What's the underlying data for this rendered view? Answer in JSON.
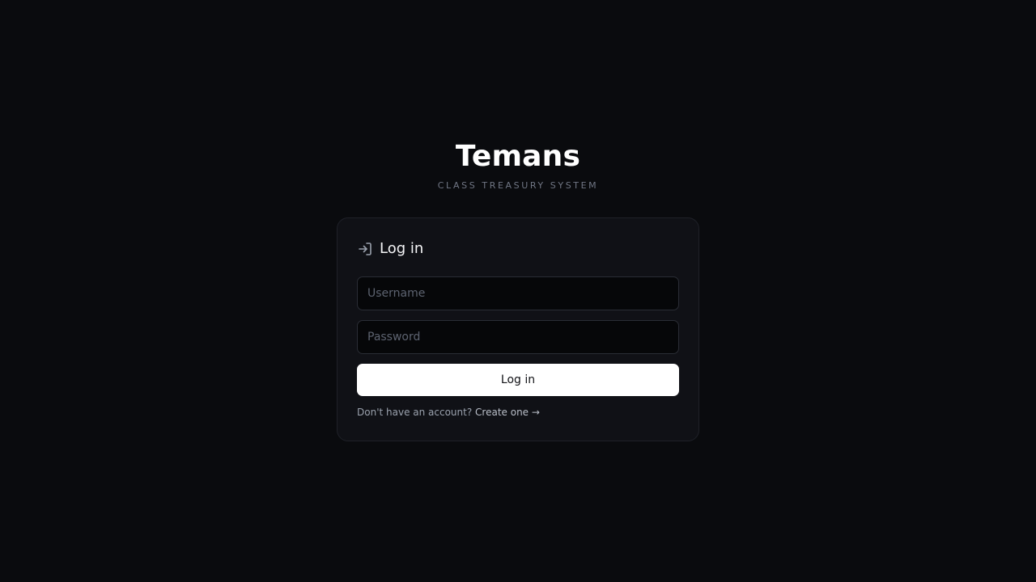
{
  "brand": {
    "title": "Temans",
    "subtitle": "CLASS TREASURY SYSTEM"
  },
  "login_card": {
    "icon": "login-arrow-icon",
    "title": "Log in",
    "username": {
      "value": "",
      "placeholder": "Username"
    },
    "password": {
      "value": "",
      "placeholder": "Password"
    },
    "submit_label": "Log in",
    "signup_prompt": "Don't have an account?",
    "signup_link": "Create one →"
  },
  "colors": {
    "background": "#0a0b0e",
    "card": "#101116",
    "card_border": "#1f2128",
    "button_bg": "#ffffff",
    "muted_text": "#707684"
  }
}
